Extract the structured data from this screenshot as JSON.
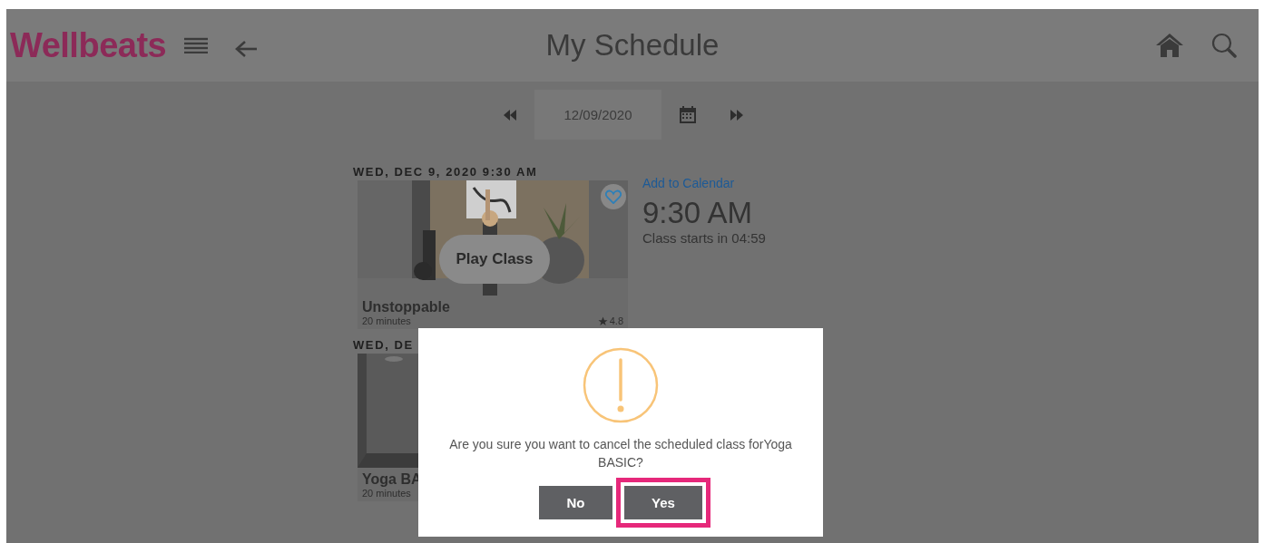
{
  "header": {
    "logo": "Wellbeats",
    "title": "My Schedule"
  },
  "date_picker": {
    "date": "12/09/2020"
  },
  "schedule": [
    {
      "heading": "WED, DEC 9, 2020 9:30 AM",
      "class_name": "Unstoppable",
      "duration": "20 minutes",
      "rating": "4.8",
      "favorite": false,
      "play_label": "Play Class",
      "add_to_calendar": "Add to Calendar",
      "start_time": "9:30 AM",
      "countdown": "Class starts in 04:59"
    },
    {
      "heading": "WED, DE",
      "class_name": "Yoga BA",
      "duration": "20 minutes"
    }
  ],
  "dialog": {
    "message": "Are you sure you want to cancel the scheduled class forYoga BASIC?",
    "buttons": [
      {
        "label": "No",
        "highlighted": false
      },
      {
        "label": "Yes",
        "highlighted": true
      }
    ]
  }
}
